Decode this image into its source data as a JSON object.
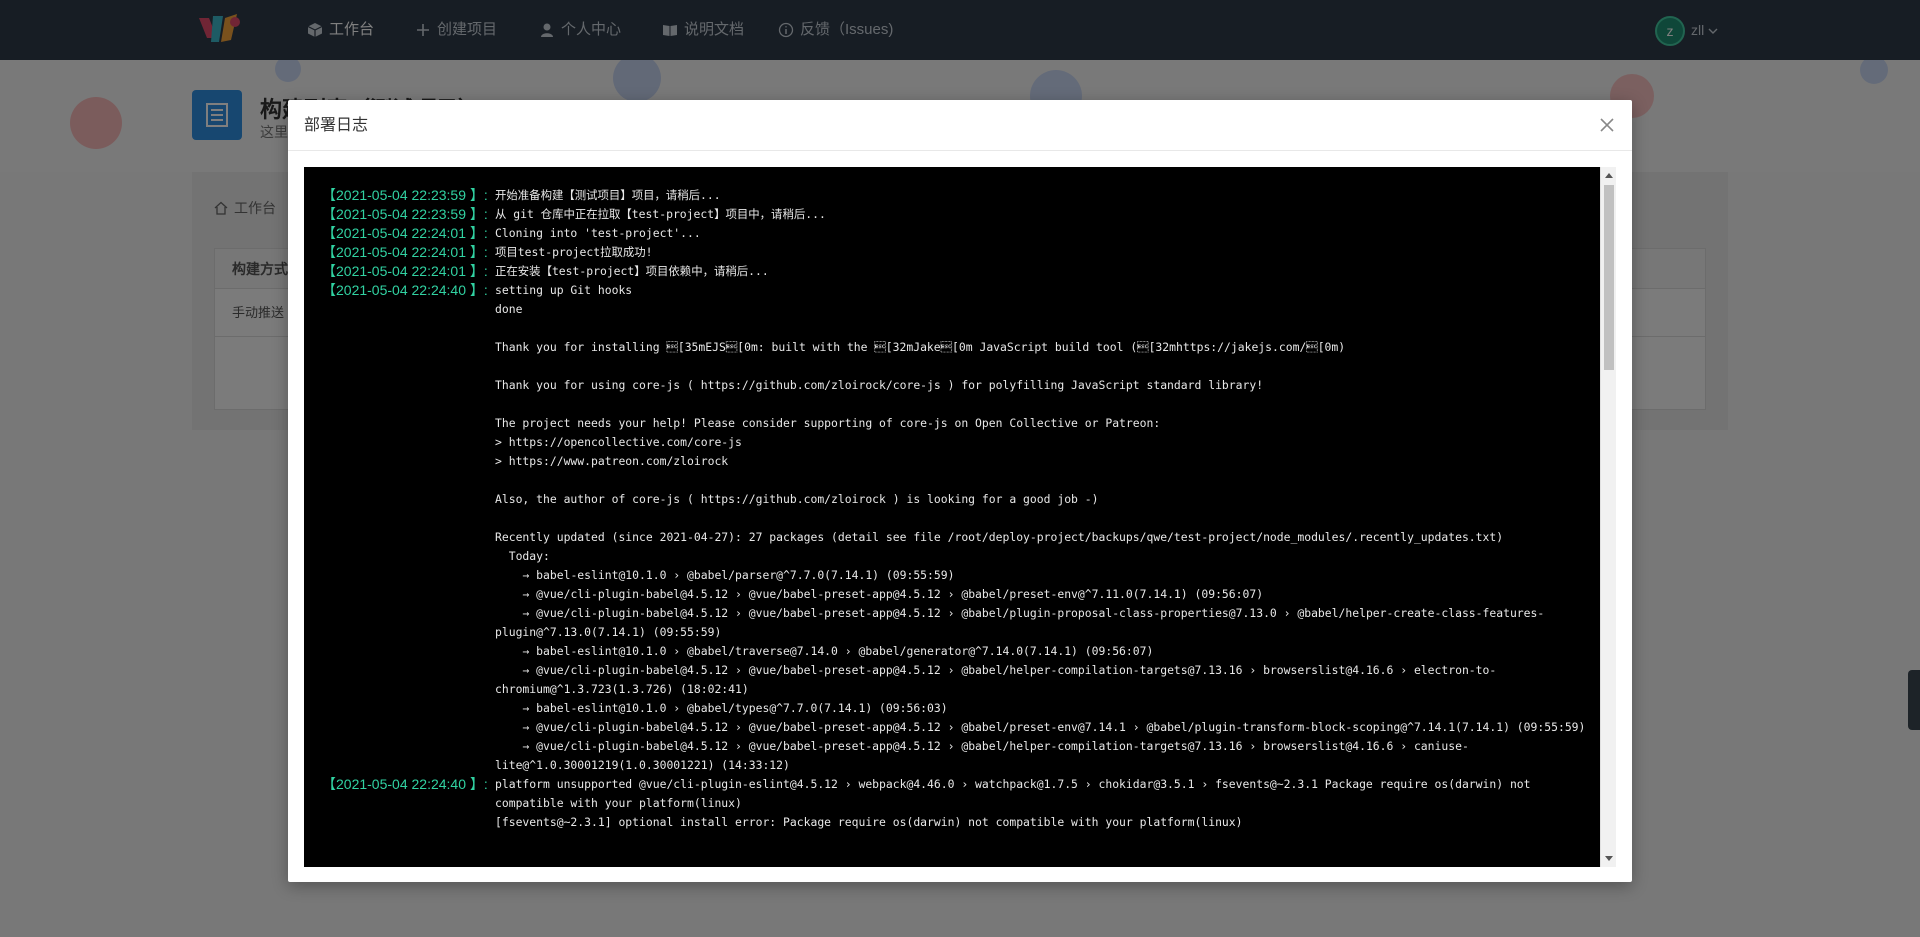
{
  "nav": {
    "items": [
      {
        "label": "工作台",
        "icon": "cube-icon",
        "active": true
      },
      {
        "label": "创建项目",
        "icon": "plus-icon",
        "active": false
      },
      {
        "label": "个人中心",
        "icon": "user-icon",
        "active": false
      },
      {
        "label": "说明文档",
        "icon": "book-icon",
        "active": false
      },
      {
        "label": "反馈（Issues)",
        "icon": "info-icon",
        "active": false
      }
    ],
    "user_initial": "z",
    "user_name": "zll"
  },
  "page": {
    "title": "构建列表（测试项目）",
    "subtitle": "这里"
  },
  "breadcrumb": {
    "home": "工作台"
  },
  "table": {
    "header": "构建方式",
    "row_first_cell": "手动推送"
  },
  "modal": {
    "title": "部署日志",
    "close_icon": "close-icon"
  },
  "colors": {
    "navbar": "#2e3a48",
    "timestamp": "#31d2a2",
    "console_bg": "#000000",
    "console_text": "#e8e8e8"
  },
  "log": [
    {
      "time": "【2021-05-04 22:23:59 】:",
      "lines": [
        "开始准备构建【测试项目】项目，请稍后..."
      ]
    },
    {
      "time": "【2021-05-04 22:23:59 】:",
      "lines": [
        "从 git 仓库中正在拉取【test-project】项目中，请稍后..."
      ]
    },
    {
      "time": "【2021-05-04 22:24:01 】:",
      "lines": [
        "Cloning into 'test-project'..."
      ]
    },
    {
      "time": "【2021-05-04 22:24:01 】:",
      "lines": [
        "项目test-project拉取成功!"
      ]
    },
    {
      "time": "【2021-05-04 22:24:01 】:",
      "lines": [
        "正在安装【test-project】项目依赖中，请稍后..."
      ]
    },
    {
      "time": "【2021-05-04 22:24:40 】:",
      "lines": [
        "setting up Git hooks",
        "done",
        "",
        "Thank you for installing \u001b[35mEJS\u001b[0m: built with the \u001b[32mJake\u001b[0m JavaScript build tool (\u001b[32mhttps://jakejs.com/\u001b[0m)",
        "",
        "Thank you for using core-js ( https://github.com/zloirock/core-js ) for polyfilling JavaScript standard library!",
        "",
        "The project needs your help! Please consider supporting of core-js on Open Collective or Patreon:",
        "> https://opencollective.com/core-js",
        "> https://www.patreon.com/zloirock",
        "",
        "Also, the author of core-js ( https://github.com/zloirock ) is looking for a good job -)",
        "",
        "Recently updated (since 2021-04-27): 27 packages (detail see file /root/deploy-project/backups/qwe/test-project/node_modules/.recently_updates.txt)",
        "  Today:",
        "    → babel-eslint@10.1.0 › @babel/parser@^7.7.0(7.14.1) (09:55:59)",
        "    → @vue/cli-plugin-babel@4.5.12 › @vue/babel-preset-app@4.5.12 › @babel/preset-env@^7.11.0(7.14.1) (09:56:07)",
        "    → @vue/cli-plugin-babel@4.5.12 › @vue/babel-preset-app@4.5.12 › @babel/plugin-proposal-class-properties@7.13.0 › @babel/helper-create-class-features-plugin@^7.13.0(7.14.1) (09:55:59)",
        "    → babel-eslint@10.1.0 › @babel/traverse@7.14.0 › @babel/generator@^7.14.0(7.14.1) (09:56:07)",
        "    → @vue/cli-plugin-babel@4.5.12 › @vue/babel-preset-app@4.5.12 › @babel/helper-compilation-targets@7.13.16 › browserslist@4.16.6 › electron-to-chromium@^1.3.723(1.3.726) (18:02:41)",
        "    → babel-eslint@10.1.0 › @babel/types@^7.7.0(7.14.1) (09:56:03)",
        "    → @vue/cli-plugin-babel@4.5.12 › @vue/babel-preset-app@4.5.12 › @babel/preset-env@7.14.1 › @babel/plugin-transform-block-scoping@^7.14.1(7.14.1) (09:55:59)",
        "    → @vue/cli-plugin-babel@4.5.12 › @vue/babel-preset-app@4.5.12 › @babel/helper-compilation-targets@7.13.16 › browserslist@4.16.6 › caniuse-lite@^1.0.30001219(1.0.30001221) (14:33:12)"
      ]
    },
    {
      "time": "【2021-05-04 22:24:40 】:",
      "lines": [
        "platform unsupported @vue/cli-plugin-eslint@4.5.12 › webpack@4.46.0 › watchpack@1.7.5 › chokidar@3.5.1 › fsevents@~2.3.1 Package require os(darwin) not compatible with your platform(linux)",
        "[fsevents@~2.3.1] optional install error: Package require os(darwin) not compatible with your platform(linux)"
      ]
    }
  ]
}
